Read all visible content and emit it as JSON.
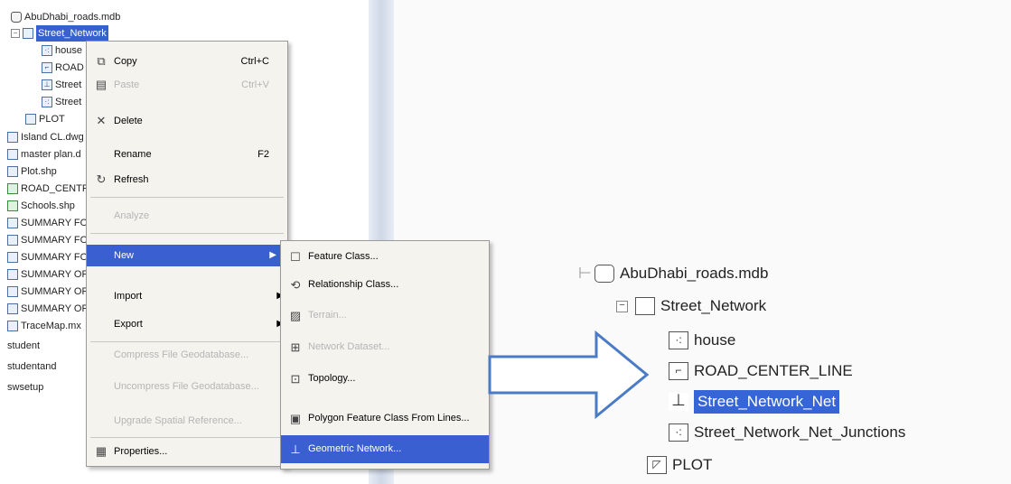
{
  "left_tree": {
    "root": "AbuDhabi_roads.mdb",
    "dataset": "Street_Network",
    "children": [
      "house",
      "ROAD",
      "Street",
      "Street"
    ],
    "plot": "PLOT",
    "files": [
      "Island CL.dwg",
      "master plan.d",
      "Plot.shp",
      "ROAD_CENTR",
      "Schools.shp",
      "SUMMARY FO",
      "SUMMARY FO",
      "SUMMARY FO",
      "SUMMARY OF",
      "SUMMARY OF",
      "SUMMARY OF",
      "TraceMap.mx",
      "student",
      "studentand",
      "swsetup"
    ]
  },
  "context_menu": {
    "items": [
      {
        "label": "Copy",
        "shortcut": "Ctrl+C",
        "icon": "copy-icon",
        "disabled": false
      },
      {
        "label": "Paste",
        "shortcut": "Ctrl+V",
        "icon": "paste-icon",
        "disabled": true
      },
      {
        "label": "Delete",
        "shortcut": "",
        "icon": "delete-icon",
        "disabled": false
      },
      {
        "label": "Rename",
        "shortcut": "F2",
        "icon": "",
        "disabled": false
      },
      {
        "label": "Refresh",
        "shortcut": "",
        "icon": "refresh-icon",
        "disabled": false
      },
      {
        "label": "Analyze",
        "shortcut": "",
        "icon": "",
        "disabled": true
      },
      {
        "label": "New",
        "shortcut": "",
        "icon": "",
        "disabled": false
      },
      {
        "label": "Import",
        "shortcut": "",
        "icon": "",
        "disabled": false
      },
      {
        "label": "Export",
        "shortcut": "",
        "icon": "",
        "disabled": false
      },
      {
        "label": "Compress File Geodatabase...",
        "shortcut": "",
        "icon": "",
        "disabled": true
      },
      {
        "label": "Uncompress File Geodatabase...",
        "shortcut": "",
        "icon": "",
        "disabled": true
      },
      {
        "label": "Upgrade Spatial Reference...",
        "shortcut": "",
        "icon": "",
        "disabled": true
      },
      {
        "label": "Properties...",
        "shortcut": "",
        "icon": "properties-icon",
        "disabled": false
      }
    ]
  },
  "submenu": {
    "items": [
      {
        "label": "Feature Class...",
        "disabled": false
      },
      {
        "label": "Relationship Class...",
        "disabled": false
      },
      {
        "label": "Terrain...",
        "disabled": true
      },
      {
        "label": "Network Dataset...",
        "disabled": true
      },
      {
        "label": "Topology...",
        "disabled": false
      },
      {
        "label": "Polygon Feature Class From Lines...",
        "disabled": false
      },
      {
        "label": "Geometric Network...",
        "disabled": false
      }
    ]
  },
  "right_tree": {
    "root": "AbuDhabi_roads.mdb",
    "dataset": "Street_Network",
    "children": [
      "house",
      "ROAD_CENTER_LINE",
      "Street_Network_Net",
      "Street_Network_Net_Junctions"
    ],
    "plot": "PLOT"
  }
}
